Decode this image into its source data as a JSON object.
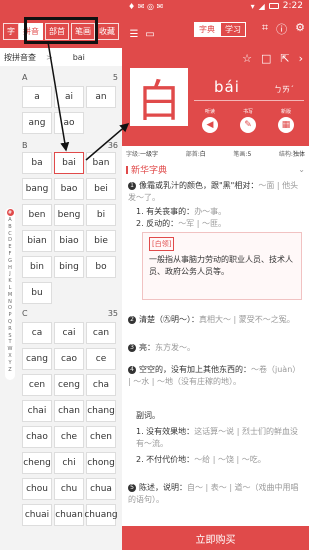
{
  "status": {
    "left": "♦ ✉ ◎ ✉",
    "time": "2:22"
  },
  "left_tabs": {
    "zi": "字",
    "pinyin": "拼音",
    "bushou": "部首",
    "bihua": "笔画",
    "shoucang": "收藏"
  },
  "search": {
    "label": "按拼音查",
    "arrow": ">",
    "value": "bai"
  },
  "sections": [
    {
      "letter": "A",
      "count": "5"
    },
    {
      "letter": "B",
      "count": "36"
    },
    {
      "letter": "C",
      "count": "35"
    }
  ],
  "pinyin_A": [
    "a",
    "ai",
    "an",
    "ang",
    "ao"
  ],
  "pinyin_B": [
    "ba",
    "bai",
    "ban",
    "bang",
    "bao",
    "bei",
    "ben",
    "beng",
    "bi",
    "bian",
    "biao",
    "bie",
    "bin",
    "bing",
    "bo",
    "bu"
  ],
  "pinyin_C": [
    "ca",
    "cai",
    "can",
    "cang",
    "cao",
    "ce",
    "cen",
    "ceng",
    "cha",
    "chai",
    "chan",
    "chang",
    "chao",
    "che",
    "chen",
    "cheng",
    "chi",
    "chong",
    "chou",
    "chu",
    "chua",
    "chuai",
    "chuan",
    "chuang"
  ],
  "alphabet": [
    "#",
    "A",
    "B",
    "C",
    "D",
    "E",
    "F",
    "G",
    "H",
    "J",
    "K",
    "L",
    "M",
    "N",
    "O",
    "P",
    "Q",
    "R",
    "S",
    "T",
    "W",
    "X",
    "Y",
    "Z"
  ],
  "right_tabs": {
    "zidian": "字典",
    "xuexi": "学习"
  },
  "hero": {
    "char": "白",
    "pinyin": "bái",
    "zhuyin": "ㄅㄞˊ",
    "btn_listen": "听读",
    "btn_write": "书写",
    "btn_book": "新版"
  },
  "meta": {
    "level_label": "字级:",
    "level": "一级字",
    "radical_label": "部首:",
    "radical": "白",
    "strokes_label": "笔画:",
    "strokes": "5",
    "structure_label": "结构:",
    "structure": "独体"
  },
  "dict": {
    "name": "新华字典"
  },
  "defs": {
    "d1": "像霜或乳汁的颜色，跟\"黑\"相对：",
    "d1_ex": "～面 | 他头发～了。",
    "d1_s1": "1. 有关丧事的：",
    "d1_s1_ex": "办～事。",
    "d1_s2": "2. 反动的：",
    "d1_s2_ex": "～军 | ～匪。",
    "note_tag": "[白领]",
    "note": "一般指从事脑力劳动的职业人员、技术人员、政府公务人员等。",
    "d2": "清楚（㊈明～）：",
    "d2_ex": "真相大～ | 蒙受不～之冤。",
    "d3": "亮：",
    "d3_ex": "东方发～。",
    "d4": "空空的，没有加上其他东西的：",
    "d4_ex": "～卷（juàn） | ～水 | ～地（没有庄稼的地）。",
    "d4_sub": "副词。",
    "d4_s1": "1. 没有效果地：",
    "d4_s1_ex": "这话算～说 | 烈士们的鲜血没有～流。",
    "d4_s2": "2. 不付代价地：",
    "d4_s2_ex": "～给 | ～饶 | ～吃。",
    "d5": "陈述，说明：",
    "d5_ex": "自～ | 表～ | 道～（戏曲中用唱的语句）。"
  },
  "buy": {
    "label": "立即购买"
  }
}
